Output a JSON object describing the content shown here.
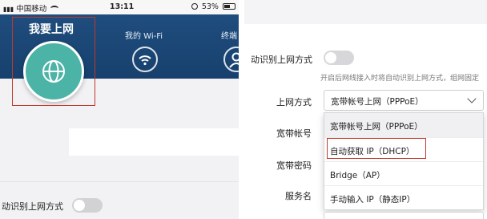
{
  "left_screen": {
    "status_bar": {
      "carrier": "中国移动",
      "time": "13:11",
      "battery_percent": "53%"
    },
    "tabs": [
      {
        "label": "我要上网",
        "icon": "globe-icon",
        "active": true
      },
      {
        "label": "我的 Wi-Fi",
        "icon": "wifi-icon"
      },
      {
        "label": "终端",
        "icon": "user-icon"
      }
    ],
    "auto_detect_label": "动识别上网方式",
    "colors": {
      "header_blue": "#1f4d7e",
      "globe_teal": "#4cb3a7",
      "highlight_red": "#c0392b"
    }
  },
  "right_screen": {
    "auto_detect": {
      "label": "动识别上网方式",
      "enabled": false,
      "help": "开启后网线接入时将自动识别上网方式，组网固定"
    },
    "conn_type": {
      "label": "上网方式",
      "selected": "宽带帐号上网（PPPoE）",
      "options": [
        "宽带帐号上网（PPPoE）",
        "自动获取 IP（DHCP）",
        "Bridge（AP）",
        "手动输入 IP（静态IP）"
      ],
      "highlighted_option": "自动获取 IP（DHCP）"
    },
    "account_label": "宽带帐号",
    "password_label": "宽带密码",
    "service_label": "服务名"
  }
}
